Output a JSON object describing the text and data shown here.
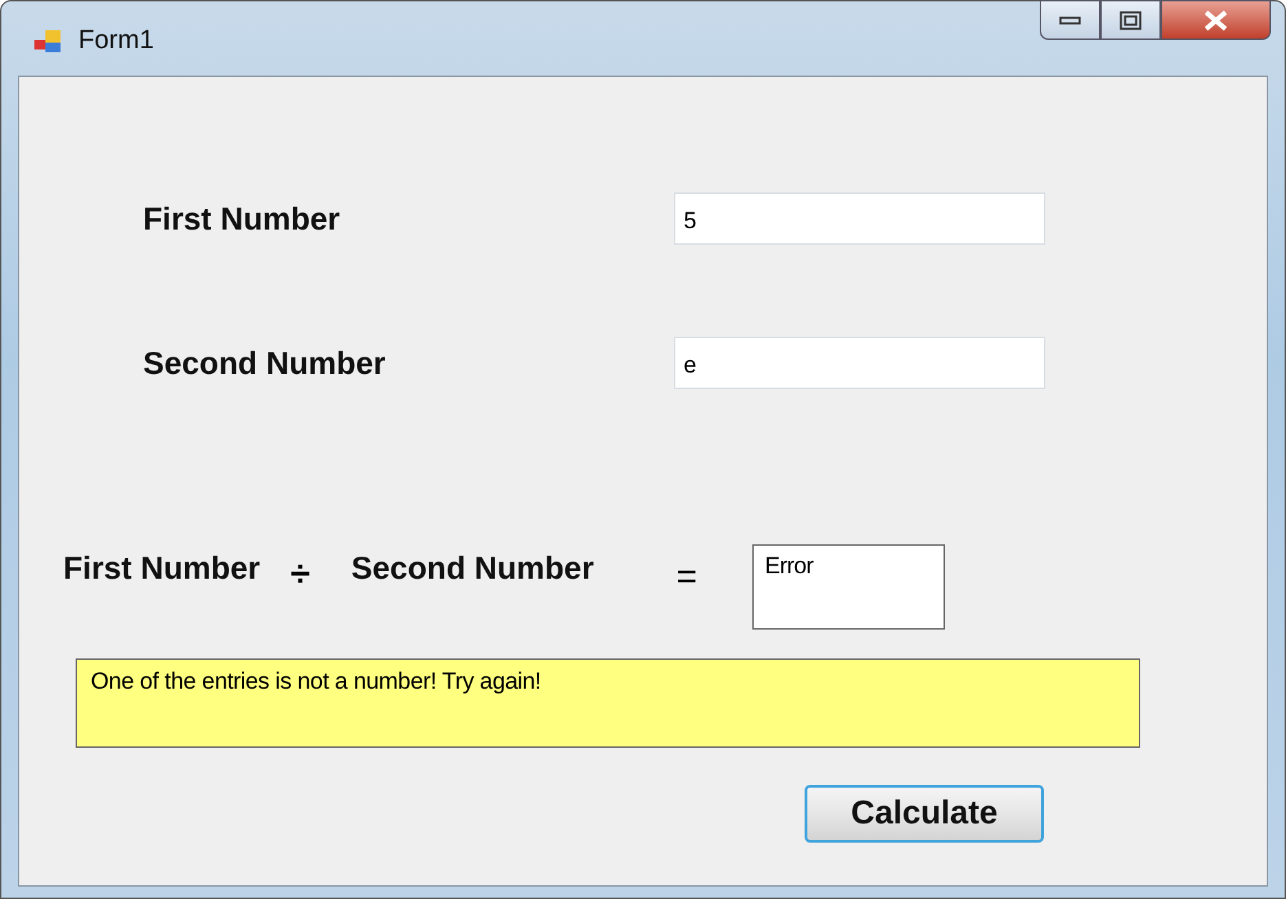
{
  "window": {
    "title": "Form1"
  },
  "inputs": [
    {
      "label": "First Number",
      "value": "5"
    },
    {
      "label": "Second Number",
      "value": "e"
    }
  ],
  "expression": {
    "left": "First Number",
    "operator": "÷",
    "right": "Second Number",
    "equals": "=",
    "result": "Error"
  },
  "message": "One of the entries is not a number! Try again!",
  "button": "Calculate"
}
